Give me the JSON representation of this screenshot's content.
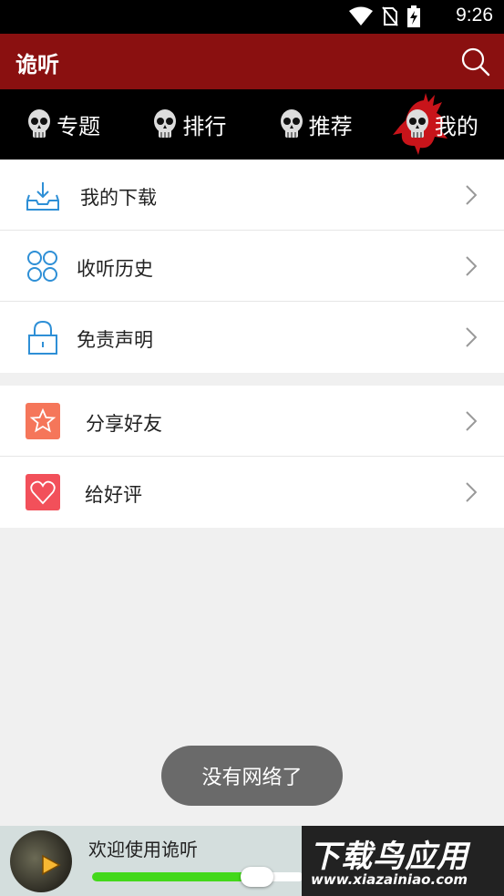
{
  "status_bar": {
    "time": "9:26"
  },
  "app_bar": {
    "title": "诡听"
  },
  "tabs": [
    {
      "label": "专题"
    },
    {
      "label": "排行"
    },
    {
      "label": "推荐"
    },
    {
      "label": "我的",
      "active": true
    }
  ],
  "menu_main": [
    {
      "label": "我的下载",
      "icon": "download-tray-icon"
    },
    {
      "label": "收听历史",
      "icon": "four-circles-icon"
    },
    {
      "label": "免责声明",
      "icon": "lock-icon"
    }
  ],
  "menu_secondary": [
    {
      "label": "分享好友",
      "icon": "star-icon"
    },
    {
      "label": "给好评",
      "icon": "heart-icon"
    }
  ],
  "toast": {
    "text": "没有网络了"
  },
  "player": {
    "title": "欢迎使用诡听",
    "progress": 0.78
  },
  "watermark": {
    "main": "下载鸟应用",
    "sub": "www.xiazainiao.com"
  },
  "colors": {
    "app_bar": "#8a1010",
    "accent_blue": "#2e8fd6",
    "progress": "#43d81b"
  }
}
